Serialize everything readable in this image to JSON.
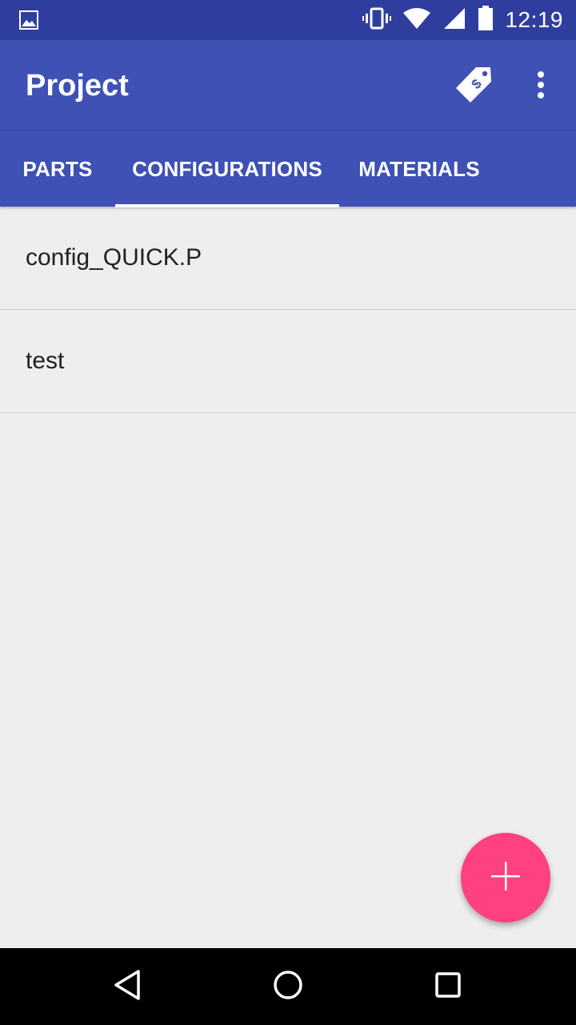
{
  "status_bar": {
    "time": "12:19",
    "icons": [
      "gallery-icon",
      "vibrate-icon",
      "wifi-icon",
      "signal-icon",
      "battery-icon"
    ]
  },
  "app_bar": {
    "title": "Project",
    "actions": [
      "price-tag-icon",
      "more-vert-icon"
    ]
  },
  "tabs": [
    {
      "label": "PARTS",
      "selected": false
    },
    {
      "label": "CONFIGURATIONS",
      "selected": true
    },
    {
      "label": "MATERIALS",
      "selected": false
    }
  ],
  "list": {
    "items": [
      {
        "label": "config_QUICK.P"
      },
      {
        "label": "test"
      }
    ]
  },
  "fab": {
    "icon": "plus-icon"
  },
  "nav_bar": {
    "icons": [
      "back-icon",
      "home-icon",
      "recent-apps-icon"
    ]
  },
  "colors": {
    "status_bar": "#2f3e9e",
    "primary": "#3f51b5",
    "accent": "#ff4081",
    "background": "#eeeeee"
  }
}
